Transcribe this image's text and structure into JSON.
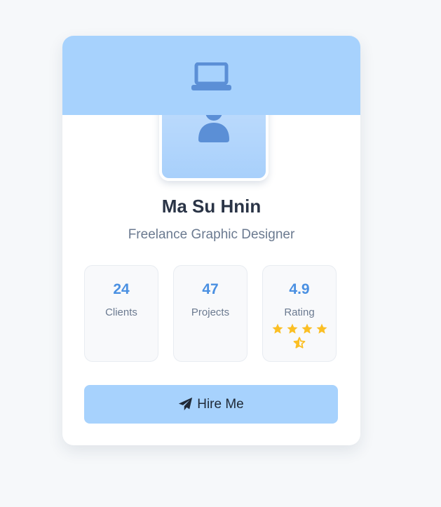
{
  "profile": {
    "name": "Ma Su Hnin",
    "title": "Freelance Graphic Designer"
  },
  "stats": [
    {
      "value": "24",
      "label": "Clients"
    },
    {
      "value": "47",
      "label": "Projects"
    },
    {
      "value": "4.9",
      "label": "Rating"
    }
  ],
  "rating": {
    "value": 4.9,
    "max": 5,
    "full_stars": 4,
    "half_stars": 1
  },
  "hire_button": {
    "label": "Hire Me",
    "icon": "paper-plane-icon"
  },
  "banner": {
    "icon": "laptop-icon"
  },
  "avatar": {
    "icon": "user-icon"
  },
  "colors": {
    "accent": "#4a90e2",
    "banner": "#a7d2fd",
    "button": "#a7d2fd",
    "star": "#fbbf24",
    "icon": "#5b8fd6",
    "heading": "#2a3446",
    "muted": "#6b7a90",
    "background": "#f6f8fa"
  }
}
